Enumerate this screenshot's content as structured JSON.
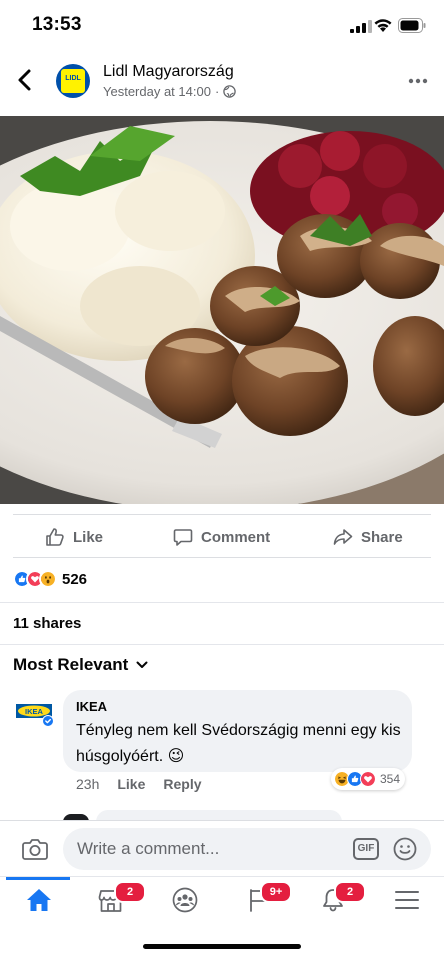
{
  "status_bar": {
    "time": "13:53"
  },
  "post": {
    "page_name": "Lidl Magyarország",
    "logo_text": "LIDL",
    "timestamp": "Yesterday at 14:00",
    "meta_separator": "·"
  },
  "actions": {
    "like_label": "Like",
    "comment_label": "Comment",
    "share_label": "Share"
  },
  "reactions": {
    "types": [
      "like",
      "love",
      "wow"
    ],
    "count": "526"
  },
  "shares": {
    "label": "11 shares"
  },
  "comments": {
    "sort_label": "Most Relevant",
    "items": [
      {
        "author": "IKEA",
        "avatar_text": "IKEA",
        "text": "Tényleg nem kell Svédországig menni egy kis húsgolyóért. 😉",
        "age": "23h",
        "like_label": "Like",
        "reply_label": "Reply",
        "reaction_types": [
          "haha",
          "like",
          "love"
        ],
        "reaction_count": "354"
      }
    ]
  },
  "composer": {
    "placeholder": "Write a comment...",
    "gif_label": "GIF"
  },
  "nav": {
    "items": [
      {
        "name": "home",
        "badge": ""
      },
      {
        "name": "marketplace",
        "badge": "2"
      },
      {
        "name": "groups",
        "badge": ""
      },
      {
        "name": "pages",
        "badge": "9+"
      },
      {
        "name": "notifications",
        "badge": "2"
      },
      {
        "name": "menu",
        "badge": ""
      }
    ]
  },
  "colors": {
    "accent": "#1877f2",
    "badge": "#e41e3f",
    "secondary_text": "#65676b"
  }
}
